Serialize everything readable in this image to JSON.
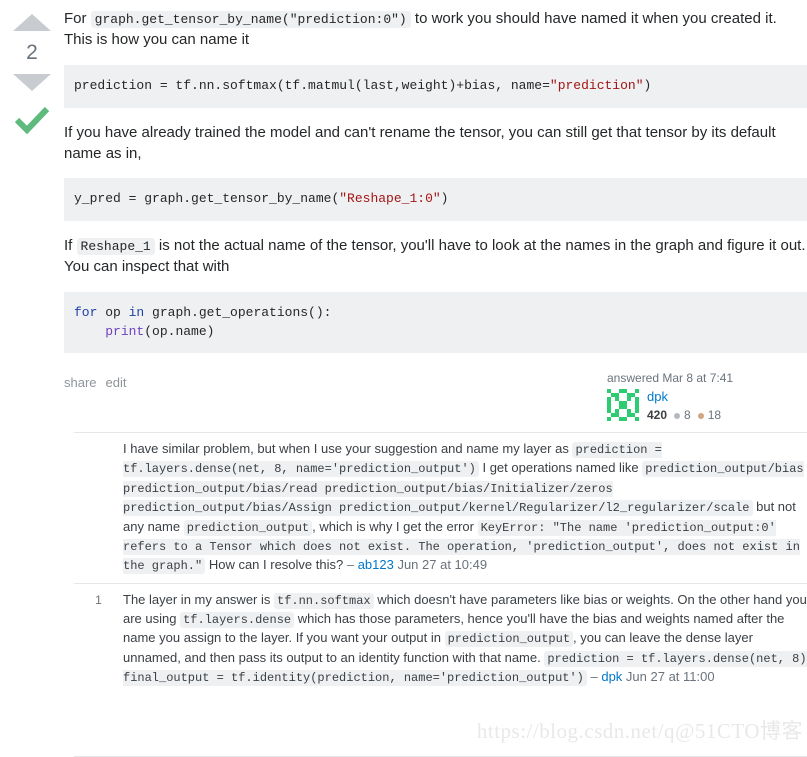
{
  "answer": {
    "vote": {
      "up_icon": "triangle-up-icon",
      "down_icon": "triangle-down-icon",
      "score": "2",
      "accepted_icon": "checkmark-icon",
      "accepted_color": "#5eba7d"
    },
    "paragraphs": {
      "p1_a": "For ",
      "p1_code": "graph.get_tensor_by_name(\"prediction:0\")",
      "p1_b": " to work you should have named it when you created it. This is how you can name it",
      "p2": "If you have already trained the model and can't rename the tensor, you can still get that tensor by its default name as in,",
      "p3_a": "If ",
      "p3_code": "Reshape_1",
      "p3_b": " is not the actual name of the tensor, you'll have to look at the names in the graph and figure it out. You can inspect that with"
    },
    "code_blocks": {
      "block1": {
        "pre": "prediction = tf.nn.softmax(tf.matmul(last,weight)+bias, name=",
        "string": "\"prediction\"",
        "post": ")"
      },
      "block2": {
        "pre": "y_pred = graph.get_tensor_by_name(",
        "string": "\"Reshape_1:0\"",
        "post": ")"
      },
      "block3": {
        "kw1": "for",
        "mid1": " op ",
        "kw2": "in",
        "mid2": " graph.get_operations():\n    ",
        "fn": "print",
        "tail": "(op.name)"
      }
    },
    "actions": {
      "share": "share",
      "edit": "edit"
    },
    "user_card": {
      "action_time": "answered Mar 8 at 7:41",
      "avatar_name": "identicon-avatar",
      "user_name": "dpk",
      "reputation": "420",
      "silver_badges": "8",
      "bronze_badges": "18"
    }
  },
  "comments": [
    {
      "score": "",
      "segments": [
        {
          "type": "text",
          "value": "I have similar problem, but when I use your suggestion and name my layer as "
        },
        {
          "type": "code",
          "value": "prediction = tf.layers.dense(net, 8, name='prediction_output')"
        },
        {
          "type": "text",
          "value": " I get operations named like "
        },
        {
          "type": "code",
          "value": "prediction_output/bias prediction_output/bias/read prediction_output/bias/Initializer/zeros prediction_output/bias/Assign prediction_output/kernel/Regularizer/l2_regularizer/scale"
        },
        {
          "type": "text",
          "value": " but not any name "
        },
        {
          "type": "code",
          "value": "prediction_output"
        },
        {
          "type": "text",
          "value": ", which is why I get the error "
        },
        {
          "type": "code",
          "value": "KeyError: \"The name 'prediction_output:0' refers to a Tensor which does not exist. The operation, 'prediction_output', does not exist in the graph.\""
        },
        {
          "type": "text",
          "value": " How can I resolve this? "
        }
      ],
      "dash": "– ",
      "user": "ab123",
      "date": " Jun 27 at 10:49"
    },
    {
      "score": "1",
      "segments": [
        {
          "type": "text",
          "value": "The layer in my answer is "
        },
        {
          "type": "code",
          "value": "tf.nn.softmax"
        },
        {
          "type": "text",
          "value": " which doesn't have parameters like bias or weights. On the other hand you are using "
        },
        {
          "type": "code",
          "value": "tf.layers.dense"
        },
        {
          "type": "text",
          "value": " which has those parameters, hence you'll have the bias and weights named after the name you assign to the layer. If you want your output in "
        },
        {
          "type": "code",
          "value": "prediction_output"
        },
        {
          "type": "text",
          "value": ", you can leave the dense layer unnamed, and then pass its output to an identity function with that name. "
        },
        {
          "type": "code",
          "value": "prediction = tf.layers.dense(net, 8) final_output = tf.identity(prediction, name='prediction_output')"
        },
        {
          "type": "text",
          "value": " "
        }
      ],
      "dash": "– ",
      "user": "dpk",
      "date": " Jun 27 at 11:00"
    }
  ],
  "watermark": {
    "text": "https://blog.csdn.net/q@51CTO博客"
  }
}
